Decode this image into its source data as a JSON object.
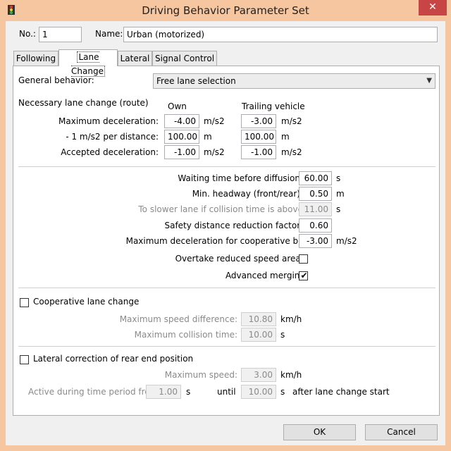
{
  "window": {
    "title": "Driving Behavior Parameter Set",
    "close_glyph": "✕"
  },
  "header": {
    "no_label": "No.:",
    "no_value": "1",
    "name_label": "Name:",
    "name_value": "Urban (motorized)"
  },
  "tabs": [
    {
      "label": "Following",
      "active": false
    },
    {
      "label": "Lane Change",
      "active": true
    },
    {
      "label": "Lateral",
      "active": false
    },
    {
      "label": "Signal Control",
      "active": false
    }
  ],
  "general": {
    "label": "General behavior:",
    "value": "Free lane selection"
  },
  "necessary": {
    "title": "Necessary lane change (route)",
    "col_own": "Own",
    "col_trailing": "Trailing vehicle",
    "rows": [
      {
        "label": "Maximum deceleration:",
        "own": "-4.00",
        "own_unit": "m/s2",
        "trailing": "-3.00",
        "trailing_unit": "m/s2"
      },
      {
        "label": "- 1 m/s2 per distance:",
        "own": "100.00",
        "own_unit": "m",
        "trailing": "100.00",
        "trailing_unit": "m"
      },
      {
        "label": "Accepted deceleration:",
        "own": "-1.00",
        "own_unit": "m/s2",
        "trailing": "-1.00",
        "trailing_unit": "m/s2"
      }
    ]
  },
  "params": {
    "waiting": {
      "label": "Waiting time before diffusion:",
      "value": "60.00",
      "unit": "s"
    },
    "headway": {
      "label": "Min. headway (front/rear):",
      "value": "0.50",
      "unit": "m"
    },
    "slower": {
      "label": "To slower lane if collision time is above",
      "value": "11.00",
      "unit": "s"
    },
    "safety": {
      "label": "Safety distance reduction factor:",
      "value": "0.60"
    },
    "coop_braking": {
      "label": "Maximum deceleration for cooperative braking:",
      "value": "-3.00",
      "unit": "m/s2"
    },
    "overtake": {
      "label": "Overtake reduced speed areas",
      "checked": false
    },
    "advanced": {
      "label": "Advanced merging",
      "checked": true,
      "check_glyph": "✔"
    }
  },
  "cooperative": {
    "label": "Cooperative lane change",
    "checked": false,
    "speed_diff": {
      "label": "Maximum speed difference:",
      "value": "10.80",
      "unit": "km/h"
    },
    "collision": {
      "label": "Maximum collision time:",
      "value": "10.00",
      "unit": "s"
    }
  },
  "lateral_corr": {
    "label": "Lateral correction of rear end position",
    "checked": false,
    "max_speed": {
      "label": "Maximum speed:",
      "value": "3.00",
      "unit": "km/h"
    },
    "period": {
      "label": "Active during time period from",
      "from": "1.00",
      "from_unit": "s",
      "until_label": "until",
      "until": "10.00",
      "until_unit": "s",
      "after_label": "after lane change start"
    }
  },
  "buttons": {
    "ok": "OK",
    "cancel": "Cancel"
  },
  "colors": {
    "frame": "#f5c6a0",
    "close": "#c74545"
  }
}
